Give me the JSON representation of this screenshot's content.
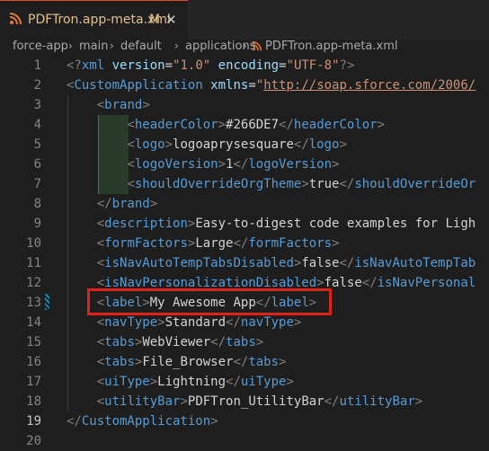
{
  "tab": {
    "title": "PDFTron.app-meta.xml",
    "modified": "M",
    "close": "✕"
  },
  "breadcrumb": [
    "force-app",
    "main",
    "default",
    "applications",
    "PDFTron.app-meta.xml"
  ],
  "line_numbers": [
    "1",
    "2",
    "3",
    "4",
    "5",
    "6",
    "7",
    "8",
    "9",
    "10",
    "11",
    "12",
    "13",
    "14",
    "15",
    "16",
    "17",
    "18",
    "19",
    "20"
  ],
  "active_line": "19",
  "lines": [
    {
      "tokens": [
        [
          "t",
          "<?"
        ],
        [
          "tn",
          "xml"
        ],
        [
          "tx",
          " "
        ],
        [
          "an",
          "version"
        ],
        [
          "tx",
          "="
        ],
        [
          "av",
          "\"1.0\""
        ],
        [
          "tx",
          " "
        ],
        [
          "an",
          "encoding"
        ],
        [
          "tx",
          "="
        ],
        [
          "av",
          "\"UTF-8\""
        ],
        [
          "t",
          "?>"
        ]
      ]
    },
    {
      "tokens": [
        [
          "t",
          "<"
        ],
        [
          "tn",
          "CustomApplication"
        ],
        [
          "tx",
          " "
        ],
        [
          "an",
          "xmlns"
        ],
        [
          "tx",
          "="
        ],
        [
          "av",
          "\""
        ],
        [
          "url",
          "http://soap.sforce.com/2006/"
        ]
      ]
    },
    {
      "tokens": [
        [
          "tx",
          "    "
        ],
        [
          "t",
          "<"
        ],
        [
          "tn",
          "brand"
        ],
        [
          "t",
          ">"
        ]
      ]
    },
    {
      "tokens": [
        [
          "tx",
          "        "
        ],
        [
          "t",
          "<"
        ],
        [
          "tn",
          "headerColor"
        ],
        [
          "t",
          ">"
        ],
        [
          "tx",
          "#266DE7"
        ],
        [
          "t",
          "</"
        ],
        [
          "tn",
          "headerColor"
        ],
        [
          "t",
          ">"
        ]
      ]
    },
    {
      "tokens": [
        [
          "tx",
          "        "
        ],
        [
          "t",
          "<"
        ],
        [
          "tn",
          "logo"
        ],
        [
          "t",
          ">"
        ],
        [
          "tx",
          "logoaprysesquare"
        ],
        [
          "t",
          "</"
        ],
        [
          "tn",
          "logo"
        ],
        [
          "t",
          ">"
        ]
      ]
    },
    {
      "tokens": [
        [
          "tx",
          "        "
        ],
        [
          "t",
          "<"
        ],
        [
          "tn",
          "logoVersion"
        ],
        [
          "t",
          ">"
        ],
        [
          "tx",
          "1"
        ],
        [
          "t",
          "</"
        ],
        [
          "tn",
          "logoVersion"
        ],
        [
          "t",
          ">"
        ]
      ]
    },
    {
      "tokens": [
        [
          "tx",
          "        "
        ],
        [
          "t",
          "<"
        ],
        [
          "tn",
          "shouldOverrideOrgTheme"
        ],
        [
          "t",
          ">"
        ],
        [
          "tx",
          "true"
        ],
        [
          "t",
          "</"
        ],
        [
          "tn",
          "shouldOverrideOr"
        ]
      ]
    },
    {
      "tokens": [
        [
          "tx",
          "    "
        ],
        [
          "t",
          "</"
        ],
        [
          "tn",
          "brand"
        ],
        [
          "t",
          ">"
        ]
      ]
    },
    {
      "tokens": [
        [
          "tx",
          "    "
        ],
        [
          "t",
          "<"
        ],
        [
          "tn",
          "description"
        ],
        [
          "t",
          ">"
        ],
        [
          "tx",
          "Easy-to-digest code examples for Ligh"
        ]
      ]
    },
    {
      "tokens": [
        [
          "tx",
          "    "
        ],
        [
          "t",
          "<"
        ],
        [
          "tn",
          "formFactors"
        ],
        [
          "t",
          ">"
        ],
        [
          "tx",
          "Large"
        ],
        [
          "t",
          "</"
        ],
        [
          "tn",
          "formFactors"
        ],
        [
          "t",
          ">"
        ]
      ]
    },
    {
      "tokens": [
        [
          "tx",
          "    "
        ],
        [
          "t",
          "<"
        ],
        [
          "tn",
          "isNavAutoTempTabsDisabled"
        ],
        [
          "t",
          ">"
        ],
        [
          "tx",
          "false"
        ],
        [
          "t",
          "</"
        ],
        [
          "tn",
          "isNavAutoTempTab"
        ]
      ]
    },
    {
      "tokens": [
        [
          "tx",
          "    "
        ],
        [
          "t",
          "<"
        ],
        [
          "tn",
          "isNavPersonalizationDisabled"
        ],
        [
          "t",
          ">"
        ],
        [
          "tx",
          "false"
        ],
        [
          "t",
          "</"
        ],
        [
          "tn",
          "isNavPersonal"
        ]
      ]
    },
    {
      "tokens": [
        [
          "tx",
          "    "
        ],
        [
          "t",
          "<"
        ],
        [
          "tn",
          "label"
        ],
        [
          "t",
          ">"
        ],
        [
          "tx",
          "My Awesome App"
        ],
        [
          "t",
          "</"
        ],
        [
          "tn",
          "label"
        ],
        [
          "t",
          ">"
        ]
      ]
    },
    {
      "tokens": [
        [
          "tx",
          "    "
        ],
        [
          "t",
          "<"
        ],
        [
          "tn",
          "navType"
        ],
        [
          "t",
          ">"
        ],
        [
          "tx",
          "Standard"
        ],
        [
          "t",
          "</"
        ],
        [
          "tn",
          "navType"
        ],
        [
          "t",
          ">"
        ]
      ]
    },
    {
      "tokens": [
        [
          "tx",
          "    "
        ],
        [
          "t",
          "<"
        ],
        [
          "tn",
          "tabs"
        ],
        [
          "t",
          ">"
        ],
        [
          "tx",
          "WebViewer"
        ],
        [
          "t",
          "</"
        ],
        [
          "tn",
          "tabs"
        ],
        [
          "t",
          ">"
        ]
      ]
    },
    {
      "tokens": [
        [
          "tx",
          "    "
        ],
        [
          "t",
          "<"
        ],
        [
          "tn",
          "tabs"
        ],
        [
          "t",
          ">"
        ],
        [
          "tx",
          "File_Browser"
        ],
        [
          "t",
          "</"
        ],
        [
          "tn",
          "tabs"
        ],
        [
          "t",
          ">"
        ]
      ]
    },
    {
      "tokens": [
        [
          "tx",
          "    "
        ],
        [
          "t",
          "<"
        ],
        [
          "tn",
          "uiType"
        ],
        [
          "t",
          ">"
        ],
        [
          "tx",
          "Lightning"
        ],
        [
          "t",
          "</"
        ],
        [
          "tn",
          "uiType"
        ],
        [
          "t",
          ">"
        ]
      ]
    },
    {
      "tokens": [
        [
          "tx",
          "    "
        ],
        [
          "t",
          "<"
        ],
        [
          "tn",
          "utilityBar"
        ],
        [
          "t",
          ">"
        ],
        [
          "tx",
          "PDFTron_UtilityBar"
        ],
        [
          "t",
          "</"
        ],
        [
          "tn",
          "utilityBar"
        ],
        [
          "t",
          ">"
        ]
      ]
    },
    {
      "tokens": [
        [
          "t",
          "</"
        ],
        [
          "tn",
          "CustomApplication"
        ],
        [
          "t",
          ">"
        ]
      ]
    },
    {
      "tokens": []
    }
  ],
  "colors": {
    "accent": "#e0211a",
    "tag": "#569cd6",
    "attr": "#9cdcfe",
    "string": "#ce9178",
    "punct": "#808080"
  },
  "icons": {
    "file": "rss-xml-icon",
    "chevron": "chevron-right-icon"
  }
}
